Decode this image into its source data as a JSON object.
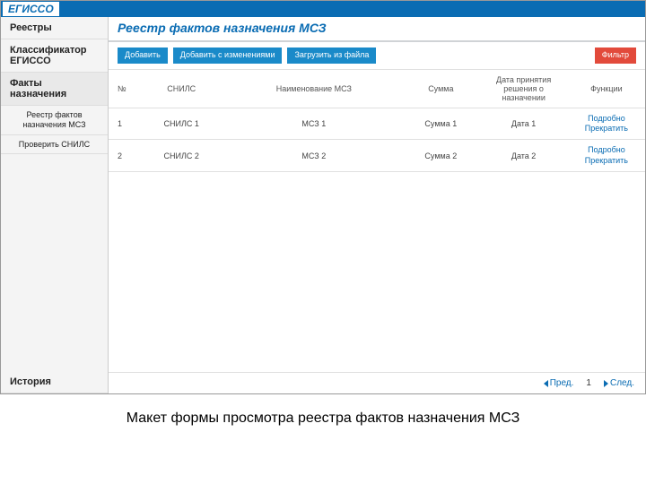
{
  "logo": "ЕГИССО",
  "sidebar": {
    "items": [
      {
        "label": "Реестры",
        "bold": true
      },
      {
        "label": "Классификатор ЕГИССО",
        "bold": true
      },
      {
        "label": "Факты назначения",
        "bold": true,
        "active": true
      },
      {
        "label": "Реестр фактов назначения МСЗ",
        "bold": false,
        "small": true
      },
      {
        "label": "Проверить СНИЛС",
        "bold": false,
        "small": true
      }
    ],
    "history": "История"
  },
  "pageTitle": "Реестр фактов назначения МСЗ",
  "toolbar": {
    "add": "Добавить",
    "addWithChanges": "Добавить с изменениями",
    "uploadFile": "Загрузить из файла",
    "filter": "Фильтр"
  },
  "table": {
    "headers": {
      "num": "№",
      "snils": "СНИЛС",
      "name": "Наименование МСЗ",
      "sum": "Сумма",
      "date": "Дата принятия решения о назначении",
      "funcs": "Функции"
    },
    "rows": [
      {
        "num": "1",
        "snils": "СНИЛС 1",
        "name": "МСЗ 1",
        "sum": "Сумма 1",
        "date": "Дата 1",
        "funcs": {
          "details": "Подробно",
          "stop": "Прекратить"
        }
      },
      {
        "num": "2",
        "snils": "СНИЛС 2",
        "name": "МСЗ 2",
        "sum": "Сумма 2",
        "date": "Дата 2",
        "funcs": {
          "details": "Подробно",
          "stop": "Прекратить"
        }
      }
    ]
  },
  "pager": {
    "prev": "Пред.",
    "page": "1",
    "next": "След."
  },
  "caption": "Макет формы просмотра реестра фактов назначения МСЗ"
}
